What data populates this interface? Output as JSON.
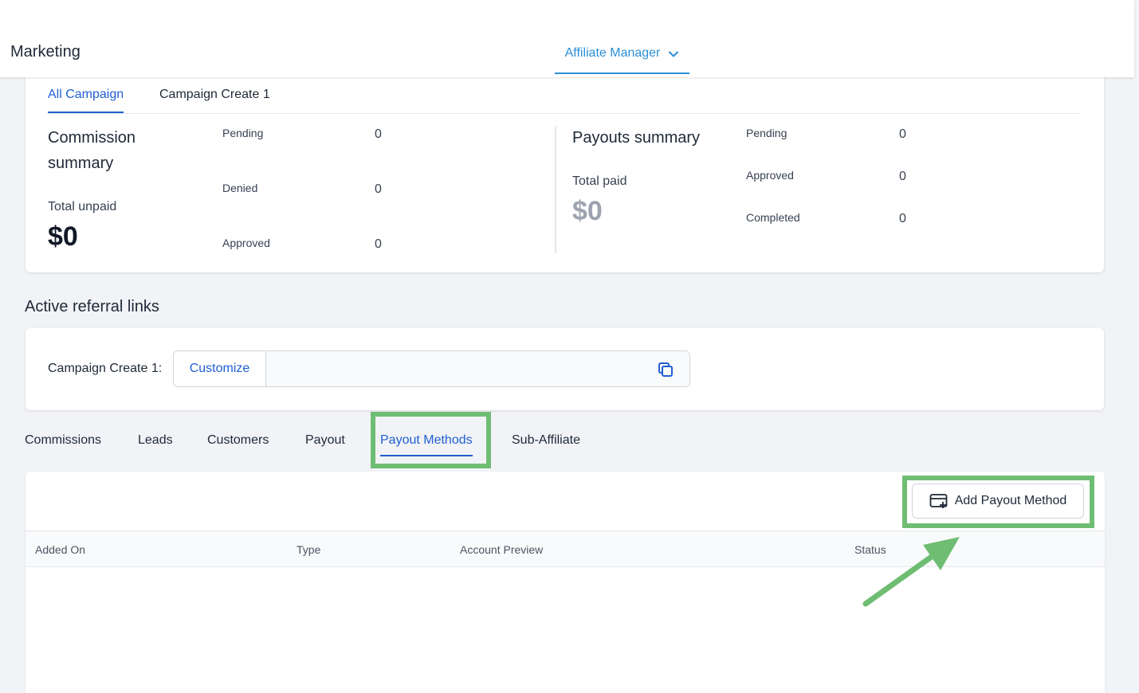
{
  "header": {
    "app_title": "Marketing",
    "nav_dropdown_label": "Affiliate Manager"
  },
  "summary": {
    "tabs": [
      {
        "label": "All Campaign",
        "active": true
      },
      {
        "label": "Campaign Create 1",
        "active": false
      }
    ],
    "commission": {
      "title_line1": "Commission",
      "title_line2": "summary",
      "total_label": "Total unpaid",
      "total_value": "$0",
      "rows": [
        {
          "label": "Pending",
          "value": "0"
        },
        {
          "label": "Denied",
          "value": "0"
        },
        {
          "label": "Approved",
          "value": "0"
        }
      ]
    },
    "payouts": {
      "title": "Payouts summary",
      "total_label": "Total paid",
      "total_value": "$0",
      "rows": [
        {
          "label": "Pending",
          "value": "0"
        },
        {
          "label": "Approved",
          "value": "0"
        },
        {
          "label": "Completed",
          "value": "0"
        }
      ]
    }
  },
  "referral": {
    "section_title": "Active referral links",
    "campaign_label": "Campaign Create 1:",
    "customize_label": "Customize",
    "link_value": ""
  },
  "bottom_tabs": [
    {
      "label": "Commissions",
      "active": false
    },
    {
      "label": "Leads",
      "active": false
    },
    {
      "label": "Customers",
      "active": false
    },
    {
      "label": "Payout",
      "active": false
    },
    {
      "label": "Payout Methods",
      "active": true
    },
    {
      "label": "Sub-Affiliate",
      "active": false
    }
  ],
  "payout_methods": {
    "add_button_label": "Add Payout Method",
    "columns": [
      "Added On",
      "Type",
      "Account Preview",
      "Status"
    ]
  },
  "colors": {
    "accent_blue": "#1f5fd1",
    "nav_blue": "#2b8fd6",
    "highlight_green": "#6fbd73",
    "page_bg": "#f1f3f6"
  }
}
